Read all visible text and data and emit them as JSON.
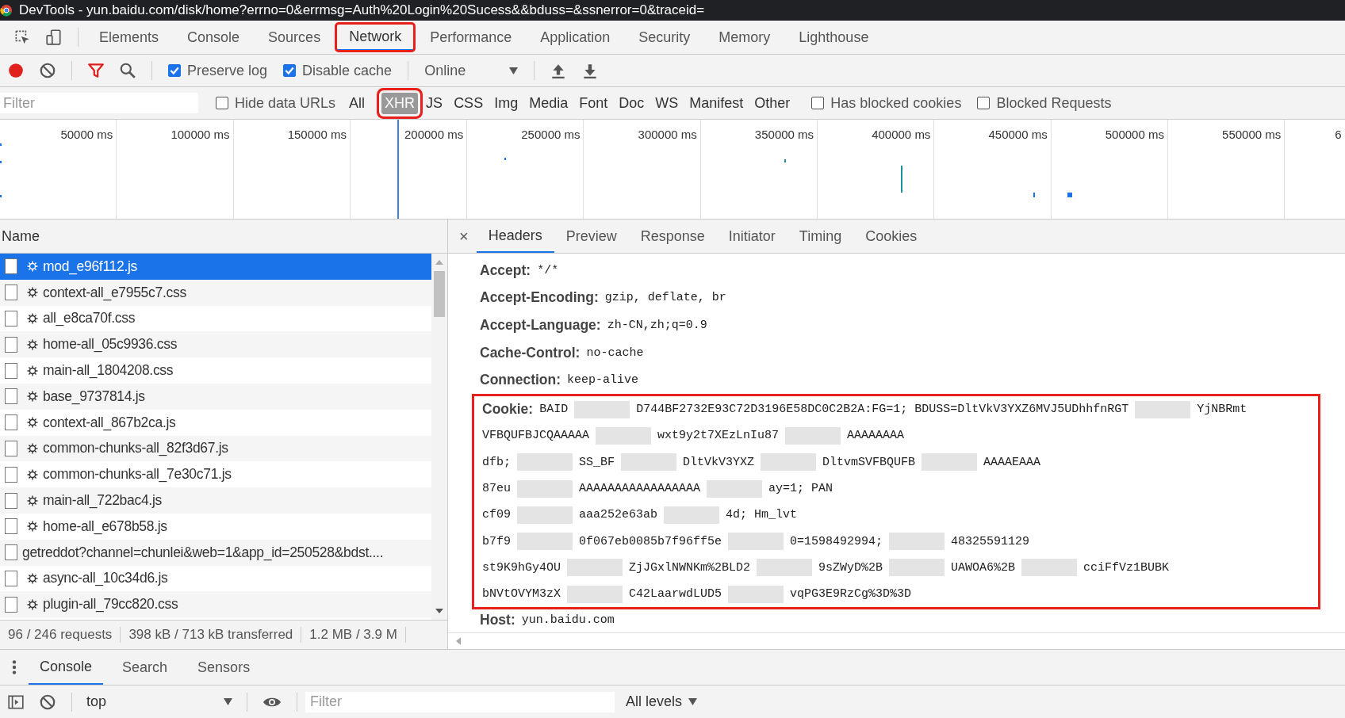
{
  "window": {
    "title": "DevTools - yun.baidu.com/disk/home?errno=0&errmsg=Auth%20Login%20Sucess&&bduss=&ssnerror=0&traceid="
  },
  "panel_tabs": [
    {
      "label": "Elements",
      "selected": false,
      "highlighted": false
    },
    {
      "label": "Console",
      "selected": false,
      "highlighted": false
    },
    {
      "label": "Sources",
      "selected": false,
      "highlighted": false
    },
    {
      "label": "Network",
      "selected": true,
      "highlighted": true
    },
    {
      "label": "Performance",
      "selected": false,
      "highlighted": false
    },
    {
      "label": "Application",
      "selected": false,
      "highlighted": false
    },
    {
      "label": "Security",
      "selected": false,
      "highlighted": false
    },
    {
      "label": "Memory",
      "selected": false,
      "highlighted": false
    },
    {
      "label": "Lighthouse",
      "selected": false,
      "highlighted": false
    }
  ],
  "toolbar": {
    "recording": true,
    "preserve_log": {
      "label": "Preserve log",
      "checked": true
    },
    "disable_cache": {
      "label": "Disable cache",
      "checked": true
    },
    "throttling": "Online"
  },
  "filter_bar": {
    "placeholder": "Filter",
    "hide_data_urls": {
      "label": "Hide data URLs",
      "checked": false
    },
    "types": [
      {
        "label": "All",
        "selected": false,
        "highlighted": false
      },
      {
        "label": "XHR",
        "selected": true,
        "highlighted": true
      },
      {
        "label": "JS",
        "selected": false,
        "highlighted": false
      },
      {
        "label": "CSS",
        "selected": false,
        "highlighted": false
      },
      {
        "label": "Img",
        "selected": false,
        "highlighted": false
      },
      {
        "label": "Media",
        "selected": false,
        "highlighted": false
      },
      {
        "label": "Font",
        "selected": false,
        "highlighted": false
      },
      {
        "label": "Doc",
        "selected": false,
        "highlighted": false
      },
      {
        "label": "WS",
        "selected": false,
        "highlighted": false
      },
      {
        "label": "Manifest",
        "selected": false,
        "highlighted": false
      },
      {
        "label": "Other",
        "selected": false,
        "highlighted": false
      }
    ],
    "has_blocked_cookies": {
      "label": "Has blocked cookies",
      "checked": false
    },
    "blocked_requests": {
      "label": "Blocked Requests",
      "checked": false
    }
  },
  "timeline": {
    "ticks": [
      "50000 ms",
      "100000 ms",
      "150000 ms",
      "200000 ms",
      "250000 ms",
      "300000 ms",
      "350000 ms",
      "400000 ms",
      "450000 ms",
      "500000 ms",
      "550000 ms",
      "6"
    ]
  },
  "requests": {
    "column": "Name",
    "rows": [
      {
        "name": "mod_e96f112.js",
        "gear": true,
        "selected": true
      },
      {
        "name": "context-all_e7955c7.css",
        "gear": true,
        "selected": false
      },
      {
        "name": "all_e8ca70f.css",
        "gear": true,
        "selected": false
      },
      {
        "name": "home-all_05c9936.css",
        "gear": true,
        "selected": false
      },
      {
        "name": "main-all_1804208.css",
        "gear": true,
        "selected": false
      },
      {
        "name": "base_9737814.js",
        "gear": true,
        "selected": false
      },
      {
        "name": "context-all_867b2ca.js",
        "gear": true,
        "selected": false
      },
      {
        "name": "common-chunks-all_82f3d67.js",
        "gear": true,
        "selected": false
      },
      {
        "name": "common-chunks-all_7e30c71.js",
        "gear": true,
        "selected": false
      },
      {
        "name": "main-all_722bac4.js",
        "gear": true,
        "selected": false
      },
      {
        "name": "home-all_e678b58.js",
        "gear": true,
        "selected": false
      },
      {
        "name": "getreddot?channel=chunlei&web=1&app_id=250528&bdst....",
        "gear": false,
        "selected": false
      },
      {
        "name": "async-all_10c34d6.js",
        "gear": true,
        "selected": false
      },
      {
        "name": "plugin-all_79cc820.css",
        "gear": true,
        "selected": false
      }
    ]
  },
  "detail": {
    "close": "×",
    "tabs": [
      {
        "label": "Headers",
        "selected": true
      },
      {
        "label": "Preview",
        "selected": false
      },
      {
        "label": "Response",
        "selected": false
      },
      {
        "label": "Initiator",
        "selected": false
      },
      {
        "label": "Timing",
        "selected": false
      },
      {
        "label": "Cookies",
        "selected": false
      }
    ],
    "headers": [
      {
        "name": "Accept:",
        "value": "*/*"
      },
      {
        "name": "Accept-Encoding:",
        "value": "gzip, deflate, br"
      },
      {
        "name": "Accept-Language:",
        "value": "zh-CN,zh;q=0.9"
      },
      {
        "name": "Cache-Control:",
        "value": "no-cache"
      },
      {
        "name": "Connection:",
        "value": "keep-alive"
      }
    ],
    "cookie": {
      "name": "Cookie:",
      "highlighted": true,
      "lines": [
        [
          {
            "text": "BAID"
          },
          {
            "kind": "redacted"
          },
          {
            "text": "D744BF2732E93C72D3196E58DC0C2B2A:FG=1; BDUSS=DltVkV3YXZ6MVJ5UDhhfnRGT"
          },
          {
            "kind": "redacted"
          },
          {
            "text": "YjNBRmt"
          }
        ],
        [
          {
            "text": "VFBQUFBJCQAAAAA"
          },
          {
            "kind": "redacted"
          },
          {
            "text": "wxt9y2t7XEzLnIu87"
          },
          {
            "kind": "redacted"
          },
          {
            "text": "AAAAAAAA"
          }
        ],
        [
          {
            "text": "dfb;"
          },
          {
            "kind": "redacted"
          },
          {
            "text": "SS_BF"
          },
          {
            "kind": "redacted"
          },
          {
            "text": "DltVkV3YXZ"
          },
          {
            "kind": "redacted"
          },
          {
            "text": "DltvmSVFBQUFB"
          },
          {
            "kind": "redacted"
          },
          {
            "text": "AAAAEAAA"
          }
        ],
        [
          {
            "text": "87eu"
          },
          {
            "kind": "redacted"
          },
          {
            "text": "AAAAAAAAAAAAAAAAA"
          },
          {
            "kind": "redacted"
          },
          {
            "text": "ay=1; PAN"
          }
        ],
        [
          {
            "text": "cf09"
          },
          {
            "kind": "redacted"
          },
          {
            "text": "aaa252e63ab"
          },
          {
            "kind": "redacted"
          },
          {
            "text": "4d; Hm_lvt"
          }
        ],
        [
          {
            "text": "b7f9"
          },
          {
            "kind": "redacted"
          },
          {
            "text": "0f067eb0085b7f96ff5e"
          },
          {
            "kind": "redacted"
          },
          {
            "text": "0=1598492994;"
          },
          {
            "kind": "redacted"
          },
          {
            "text": "48325591129"
          }
        ],
        [
          {
            "text": "st9K9hGy4OU"
          },
          {
            "kind": "redacted"
          },
          {
            "text": "ZjJGxlNWNKm%2BLD2"
          },
          {
            "kind": "redacted"
          },
          {
            "text": "9sZWyD%2B"
          },
          {
            "kind": "redacted"
          },
          {
            "text": "UAWOA6%2B"
          },
          {
            "kind": "redacted"
          },
          {
            "text": "cciFfVz1BUBK"
          }
        ],
        [
          {
            "text": "bNVtOVYM3zX"
          },
          {
            "kind": "redacted"
          },
          {
            "text": "C42LaarwdLUD5"
          },
          {
            "kind": "redacted"
          },
          {
            "text": "vqPG3E9RzCg%3D%3D"
          }
        ]
      ]
    },
    "host": {
      "name": "Host:",
      "value": "yun.baidu.com"
    }
  },
  "status_bar": [
    "96 / 246 requests",
    "398 kB / 713 kB transferred",
    "1.2 MB / 3.9 M"
  ],
  "drawer": {
    "tabs": [
      {
        "label": "Console",
        "selected": true
      },
      {
        "label": "Search",
        "selected": false
      },
      {
        "label": "Sensors",
        "selected": false
      }
    ],
    "context": "top",
    "filter_placeholder": "Filter",
    "levels": "All levels"
  }
}
